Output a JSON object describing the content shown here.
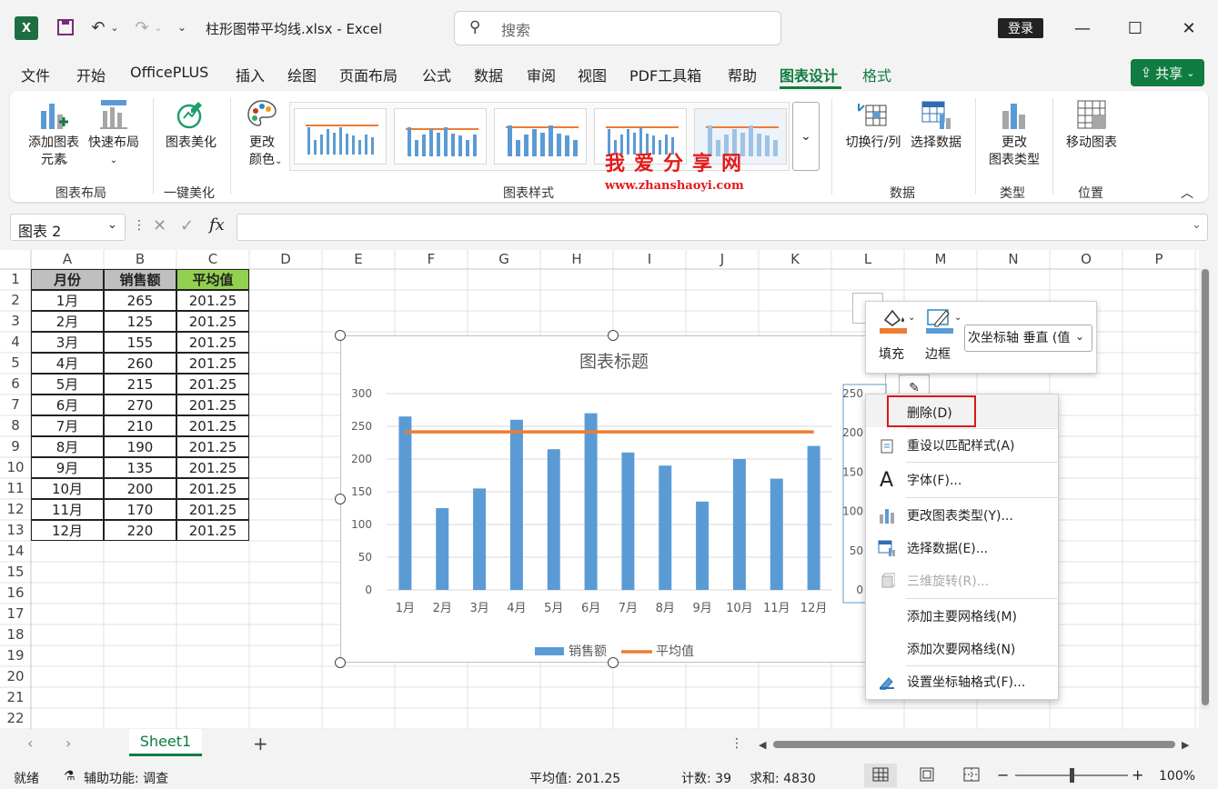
{
  "app": {
    "title": "柱形图带平均线.xlsx  -  Excel",
    "logo": "X"
  },
  "search": {
    "placeholder": "搜索"
  },
  "login_label": "登录",
  "menu": [
    "文件",
    "开始",
    "OfficePLUS",
    "插入",
    "绘图",
    "页面布局",
    "公式",
    "数据",
    "审阅",
    "视图",
    "PDF工具箱",
    "帮助",
    "图表设计",
    "格式"
  ],
  "share_label": "共享",
  "ribbon": {
    "add_element": [
      "添加图表",
      "元素"
    ],
    "quick_layout": "快速布局",
    "beautify": "图表美化",
    "change_color": [
      "更改",
      "颜色"
    ],
    "switch_rowcol": "切换行/列",
    "select_data": "选择数据",
    "change_type": [
      "更改",
      "图表类型"
    ],
    "move_chart": "移动图表",
    "groups": {
      "layout": "图表布局",
      "beautify": "一键美化",
      "styles": "图表样式",
      "data": "数据",
      "type": "类型",
      "position": "位置"
    }
  },
  "watermark": {
    "text": "我爱分享网",
    "url": "www.zhanshaoyi.com"
  },
  "namebox": "图表 2",
  "columns": [
    "A",
    "B",
    "C",
    "D",
    "E",
    "F",
    "G",
    "H",
    "I",
    "J",
    "K",
    "L",
    "M",
    "N",
    "O",
    "P"
  ],
  "rows": [
    "1",
    "2",
    "3",
    "4",
    "5",
    "6",
    "7",
    "8",
    "9",
    "10",
    "11",
    "12",
    "13",
    "14",
    "15",
    "16",
    "17",
    "18",
    "19",
    "20",
    "21",
    "22"
  ],
  "table": {
    "headers": [
      "月份",
      "销售额",
      "平均值"
    ],
    "rows": [
      [
        "1月",
        "265",
        "201.25"
      ],
      [
        "2月",
        "125",
        "201.25"
      ],
      [
        "3月",
        "155",
        "201.25"
      ],
      [
        "4月",
        "260",
        "201.25"
      ],
      [
        "5月",
        "215",
        "201.25"
      ],
      [
        "6月",
        "270",
        "201.25"
      ],
      [
        "7月",
        "210",
        "201.25"
      ],
      [
        "8月",
        "190",
        "201.25"
      ],
      [
        "9月",
        "135",
        "201.25"
      ],
      [
        "10月",
        "200",
        "201.25"
      ],
      [
        "11月",
        "170",
        "201.25"
      ],
      [
        "12月",
        "220",
        "201.25"
      ]
    ]
  },
  "chart_data": {
    "type": "bar",
    "title": "图表标题",
    "categories": [
      "1月",
      "2月",
      "3月",
      "4月",
      "5月",
      "6月",
      "7月",
      "8月",
      "9月",
      "10月",
      "11月",
      "12月"
    ],
    "series": [
      {
        "name": "销售额",
        "type": "bar",
        "color": "#5b9bd5",
        "values": [
          265,
          125,
          155,
          260,
          215,
          270,
          210,
          190,
          135,
          200,
          170,
          220
        ]
      },
      {
        "name": "平均值",
        "type": "line",
        "color": "#ed7d31",
        "values": [
          201.25,
          201.25,
          201.25,
          201.25,
          201.25,
          201.25,
          201.25,
          201.25,
          201.25,
          201.25,
          201.25,
          201.25
        ]
      }
    ],
    "ylim": [
      0,
      300
    ],
    "yticks": [
      "0",
      "50",
      "100",
      "150",
      "200",
      "250",
      "300"
    ],
    "secondary_ylim": [
      0,
      250
    ],
    "secondary_yticks": [
      "0",
      "50",
      "100",
      "150",
      "200",
      "250"
    ],
    "legend": "bottom",
    "grid": true
  },
  "format_mini": {
    "fill": "填充",
    "border": "边框",
    "selector": "次坐标轴 垂直 (值"
  },
  "context_menu": [
    {
      "label": "删除(D)",
      "icon": "none"
    },
    {
      "label": "重设以匹配样式(A)",
      "icon": "reset-style-icon"
    },
    {
      "label": "字体(F)...",
      "icon": "font-icon"
    },
    {
      "label": "更改图表类型(Y)...",
      "icon": "chart-type-icon"
    },
    {
      "label": "选择数据(E)...",
      "icon": "select-data-icon"
    },
    {
      "label": "三维旋转(R)...",
      "icon": "3d-rotate-icon",
      "disabled": true
    },
    {
      "label": "添加主要网格线(M)",
      "icon": "none"
    },
    {
      "label": "添加次要网格线(N)",
      "icon": "none"
    },
    {
      "label": "设置坐标轴格式(F)...",
      "icon": "format-axis-icon"
    }
  ],
  "sheet_tab": "Sheet1",
  "status": {
    "ready": "就绪",
    "accessibility": "辅助功能: 调查",
    "average": "平均值: 201.25",
    "count": "计数: 39",
    "sum": "求和: 4830",
    "zoom": "100%"
  },
  "colors": {
    "accent": "#107c41",
    "bar": "#5b9bd5",
    "avg_line": "#ed7d31",
    "header_green": "#92d050",
    "highlight": "#e41a1a"
  }
}
